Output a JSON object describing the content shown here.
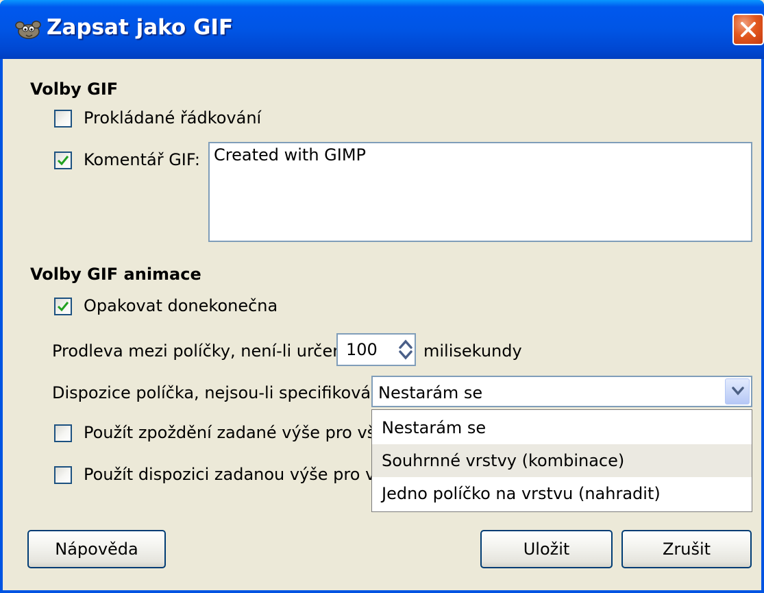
{
  "window": {
    "title": "Zapsat jako GIF"
  },
  "gif_options": {
    "heading": "Volby GIF",
    "interlace": {
      "label": "Prokládané řádkování",
      "checked": false
    },
    "comment": {
      "label": "Komentář GIF:",
      "checked": true,
      "value": "Created with GIMP"
    }
  },
  "animation_options": {
    "heading": "Volby GIF animace",
    "loop": {
      "label": "Opakovat donekonečna",
      "checked": true
    },
    "delay": {
      "label": "Prodleva mezi políčky, není-li určena:",
      "value": "100",
      "unit": "milisekundy"
    },
    "disposal": {
      "label": "Dispozice políčka, nejsou-li specifikovány:",
      "selected": "Nestarám se",
      "options": [
        "Nestarám se",
        "Souhrnné vrstvy (kombinace)",
        "Jedno políčko na vrstvu (nahradit)"
      ],
      "hovered_option_index": 1
    },
    "use_delay_all": {
      "label": "Použít zpoždění zadané výše pro všecl",
      "checked": false
    },
    "use_disposal_all": {
      "label": "Použít dispozici zadanou výše pro všec",
      "checked": false
    }
  },
  "buttons": {
    "help": "Nápověda",
    "save": "Uložit",
    "cancel": "Zrušit"
  },
  "colors": {
    "titlebar": "#0055e5",
    "dialog_bg": "#ece9d8",
    "close_button": "#e2581e",
    "checkmark": "#21a121",
    "hover_item": "#ebe9e1"
  },
  "icons": {
    "app": "gimp-wilber-icon",
    "close": "close-x-icon",
    "combo": "chevron-down-icon",
    "spin": "spin-up-down-icon"
  }
}
